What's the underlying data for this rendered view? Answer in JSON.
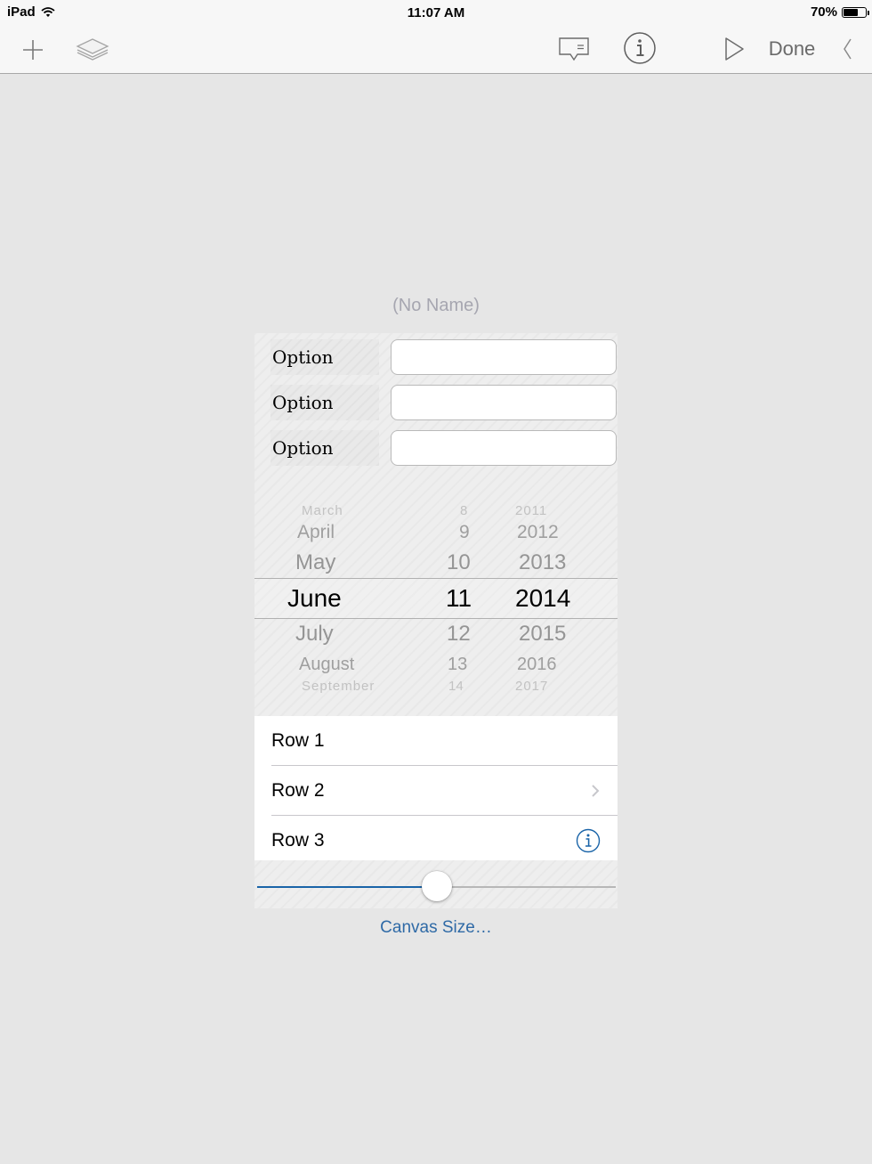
{
  "status_bar": {
    "device": "iPad",
    "time": "11:07 AM",
    "battery_text": "70%",
    "battery_level": 0.7
  },
  "toolbar": {
    "icons": [
      "plus-icon",
      "layers-icon",
      "comment-icon",
      "info-icon",
      "play-icon",
      "back-chevron-icon"
    ],
    "done_label": "Done"
  },
  "canvas": {
    "title": "(No Name)",
    "options": [
      {
        "label": "Option",
        "value": ""
      },
      {
        "label": "Option",
        "value": ""
      },
      {
        "label": "Option",
        "value": ""
      }
    ],
    "date_picker": {
      "months": [
        "March",
        "April",
        "May",
        "June",
        "July",
        "August",
        "September"
      ],
      "days": [
        "8",
        "9",
        "10",
        "11",
        "12",
        "13",
        "14"
      ],
      "years": [
        "2011",
        "2012",
        "2013",
        "2014",
        "2015",
        "2016",
        "2017"
      ],
      "selected": {
        "month": "June",
        "day": "11",
        "year": "2014"
      }
    },
    "table_rows": [
      {
        "label": "Row 1",
        "accessory": "none"
      },
      {
        "label": "Row 2",
        "accessory": "chevron-right-icon"
      },
      {
        "label": "Row 3",
        "accessory": "info-icon"
      }
    ],
    "slider_value": 0.5,
    "canvas_size_link": "Canvas Size…"
  },
  "colors": {
    "tint": "#1a64a8",
    "link": "#2f6aa6",
    "background": "#e6e6e6",
    "toolbar": "#f7f7f7"
  }
}
